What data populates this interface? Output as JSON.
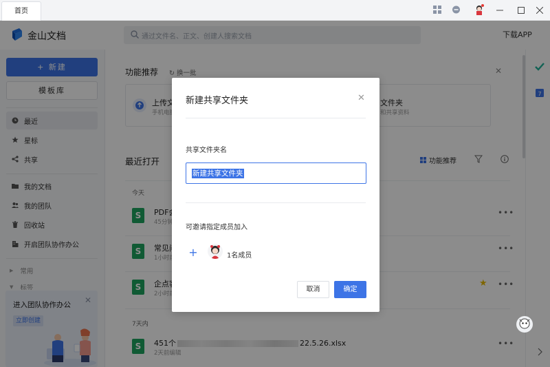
{
  "titlebar": {
    "tab_label": "首页",
    "icons": [
      "apps-grid-icon",
      "chat-icon",
      "avatar-icon",
      "minimize-icon",
      "maximize-icon",
      "close-icon"
    ]
  },
  "header": {
    "brand": "金山文档",
    "search_placeholder": "通过文件名、正文、创建人搜索文档",
    "download_label": "下载APP"
  },
  "sidebar": {
    "new_button": "+ 新建",
    "template_button": "模板库",
    "nav": [
      {
        "label": "最近",
        "icon": "clock-icon",
        "active": true
      },
      {
        "label": "星标",
        "icon": "star-icon",
        "active": false
      },
      {
        "label": "共享",
        "icon": "share-icon",
        "active": false
      },
      {
        "label": "我的文档",
        "icon": "folder-icon",
        "active": false
      },
      {
        "label": "我的团队",
        "icon": "team-icon",
        "active": false
      },
      {
        "label": "回收站",
        "icon": "trash-icon",
        "active": false
      },
      {
        "label": "开启团队协作办公",
        "icon": "building-icon",
        "active": false
      }
    ],
    "groups": [
      "常用",
      "标签"
    ],
    "promo": {
      "title": "进入团队协作办公",
      "button": "立即创建"
    }
  },
  "main": {
    "recommend_title": "功能推荐",
    "refresh_label": "换一批",
    "cards": [
      {
        "title": "上传文",
        "sub": "手机电脑"
      },
      {
        "title": "文件夹",
        "sub": "和共享资料"
      }
    ],
    "recent_label": "最近打开",
    "feature_recommend": "功能推荐",
    "sections": {
      "today": "今天",
      "week": "7天内"
    },
    "files": [
      {
        "name": "PDF会",
        "meta": "45分钟",
        "starred": false
      },
      {
        "name": "常见问",
        "meta": "1小时前",
        "starred": false
      },
      {
        "name": "企点客",
        "meta": "2小时前",
        "starred": true
      },
      {
        "name_prefix": "451个",
        "name_suffix": "22.5.26.xlsx",
        "meta": "2天前编辑",
        "starred": false
      }
    ]
  },
  "dialog": {
    "title": "新建共享文件夹",
    "folder_name_label": "共享文件夹名",
    "folder_name_value": "新建共享文件夹",
    "invite_label": "可邀请指定成员加入",
    "member_count": "1名成员",
    "cancel": "取消",
    "confirm": "确定"
  },
  "colors": {
    "accent": "#3d74e6",
    "sheet_green": "#1ea45f",
    "star": "#e6b800"
  }
}
